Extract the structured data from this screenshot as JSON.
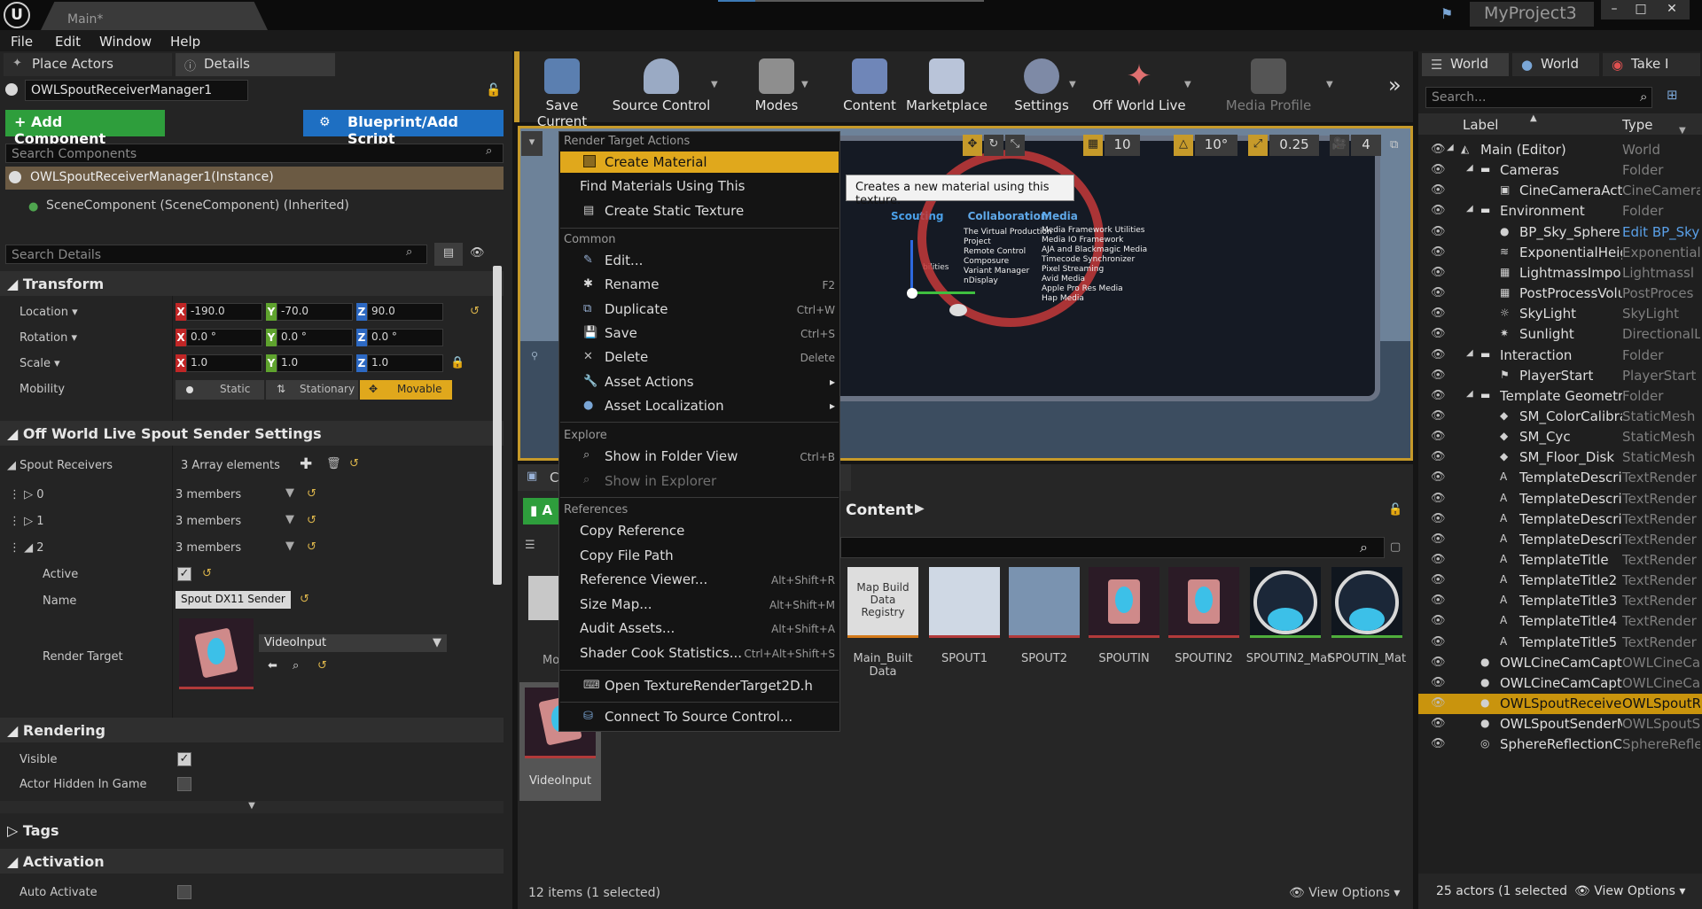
{
  "title_bar": {
    "doc_tab": "Main*",
    "project": "MyProject3",
    "minimize": "–",
    "maximize": "□",
    "close": "✕"
  },
  "menu": [
    "File",
    "Edit",
    "Window",
    "Help"
  ],
  "left_panel": {
    "tabs": [
      "Place Actors",
      "Details"
    ],
    "actor_name": "OWLSpoutReceiverManager1",
    "add_component": "+ Add Component",
    "blueprint_button": "Blueprint/Add Script",
    "search_components_placeholder": "Search Components",
    "component_instance": "OWLSpoutReceiverManager1(Instance)",
    "scene_component": "SceneComponent (SceneComponent) (Inherited)",
    "search_details_placeholder": "Search Details",
    "transform": {
      "header": "Transform",
      "location_label": "Location",
      "location": [
        "-190.0",
        "-70.0",
        "90.0"
      ],
      "rotation_label": "Rotation",
      "rotation": [
        "0.0 °",
        "0.0 °",
        "0.0 °"
      ],
      "scale_label": "Scale",
      "scale": [
        "1.0",
        "1.0",
        "1.0"
      ],
      "mobility_label": "Mobility",
      "mobility_options": [
        "Static",
        "Stationary",
        "Movable"
      ]
    },
    "owl": {
      "header": "Off World Live Spout Sender Settings",
      "receivers_label": "Spout Receivers",
      "receivers_count": "3 Array elements",
      "items": [
        {
          "index": "0",
          "members": "3 members"
        },
        {
          "index": "1",
          "members": "3 members"
        },
        {
          "index": "2",
          "members": "3 members"
        }
      ],
      "active_label": "Active",
      "name_label": "Name",
      "name_value": "Spout DX11 Sender",
      "render_target_label": "Render Target",
      "render_target_value": "VideoInput"
    },
    "rendering": {
      "header": "Rendering",
      "visible_label": "Visible",
      "hidden_label": "Actor Hidden In Game"
    },
    "tags_header": "Tags",
    "activation": {
      "header": "Activation",
      "auto_activate": "Auto Activate"
    }
  },
  "toolbar": {
    "buttons": [
      "Save Current",
      "Source Control",
      "Modes",
      "Content",
      "Marketplace",
      "Settings",
      "Off World Live",
      "Media Profile"
    ],
    "overflow": "»"
  },
  "viewport": {
    "snap_grid": "10",
    "snap_rot": "10°",
    "snap_scale": "0.25",
    "cam_speed": "4",
    "board_left": "Collaboration",
    "board_right": "Media",
    "board_items_left": [
      "The Virtual Production Project",
      "Remote Control",
      "Composure",
      "Variant Manager",
      "nDisplay"
    ],
    "board_items_right": [
      "Media Framework Utilities",
      "Media IO Framework",
      "AJA and Blackmagic Media",
      "Timecode Synchronizer",
      "Pixel Streaming",
      "Avid Media",
      "Apple Pro Res Media",
      "Hap Media"
    ],
    "scouting": "Scouting",
    "abilities": "bilities"
  },
  "context_menu": {
    "section_render": "Render Target Actions",
    "render_items": [
      "Create Material",
      "Find Materials Using This",
      "Create Static Texture"
    ],
    "section_common": "Common",
    "common_items": [
      {
        "label": "Edit...",
        "short": ""
      },
      {
        "label": "Rename",
        "short": "F2"
      },
      {
        "label": "Duplicate",
        "short": "Ctrl+W"
      },
      {
        "label": "Save",
        "short": "Ctrl+S"
      },
      {
        "label": "Delete",
        "short": "Delete"
      },
      {
        "label": "Asset Actions",
        "short": "▸"
      },
      {
        "label": "Asset Localization",
        "short": "▸"
      }
    ],
    "section_explore": "Explore",
    "explore_items": [
      {
        "label": "Show in Folder View",
        "short": "Ctrl+B"
      },
      {
        "label": "Show in Explorer",
        "short": ""
      }
    ],
    "section_references": "References",
    "reference_items": [
      {
        "label": "Copy Reference",
        "short": ""
      },
      {
        "label": "Copy File Path",
        "short": ""
      },
      {
        "label": "Reference Viewer...",
        "short": "Alt+Shift+R"
      },
      {
        "label": "Size Map...",
        "short": "Alt+Shift+M"
      },
      {
        "label": "Audit Assets...",
        "short": "Alt+Shift+A"
      },
      {
        "label": "Shader Cook Statistics...",
        "short": "Ctrl+Alt+Shift+S"
      }
    ],
    "open_item": "Open TextureRenderTarget2D.h",
    "connect_item": "Connect To Source Control..."
  },
  "tooltip": "Creates a new material using this texture.",
  "content_browser": {
    "tab_letter": "C",
    "add_letter": "A",
    "path": "Content",
    "folder_label_partial": "Mo",
    "selected_asset": "VideoInput",
    "map_build_thumb": "Map Build Data Registry",
    "assets": [
      {
        "name": "Main_Built Data"
      },
      {
        "name": "SPOUT1"
      },
      {
        "name": "SPOUT2"
      },
      {
        "name": "SPOUTIN"
      },
      {
        "name": "SPOUTIN2"
      },
      {
        "name": "SPOUTIN2_Mat"
      },
      {
        "name": "SPOUTIN_Mat"
      }
    ],
    "status": "12 items (1 selected)",
    "view_options": "View Options"
  },
  "outliner": {
    "tabs": [
      "World",
      "World",
      "Take I"
    ],
    "search_placeholder": "Search...",
    "col_label": "Label",
    "col_type": "Type",
    "rows": [
      {
        "name": "Main (Editor)",
        "type": "World",
        "indent": 0,
        "icon": "world"
      },
      {
        "name": "Cameras",
        "type": "Folder",
        "indent": 1,
        "icon": "folder"
      },
      {
        "name": "CineCameraActor",
        "type": "CineCamera",
        "indent": 2,
        "icon": "camera"
      },
      {
        "name": "Environment",
        "type": "Folder",
        "indent": 1,
        "icon": "folder"
      },
      {
        "name": "BP_Sky_Sphere",
        "type": "Edit BP_Sky",
        "indent": 2,
        "icon": "sphere"
      },
      {
        "name": "ExponentialHeigh",
        "type": "Exponential",
        "indent": 2,
        "icon": "fog"
      },
      {
        "name": "LightmassImporta",
        "type": "Lightmassl",
        "indent": 2,
        "icon": "volume"
      },
      {
        "name": "PostProcessVolu",
        "type": "PostProces",
        "indent": 2,
        "icon": "volume"
      },
      {
        "name": "SkyLight",
        "type": "SkyLight",
        "indent": 2,
        "icon": "light"
      },
      {
        "name": "Sunlight",
        "type": "DirectionalL",
        "indent": 2,
        "icon": "sun"
      },
      {
        "name": "Interaction",
        "type": "Folder",
        "indent": 1,
        "icon": "folder"
      },
      {
        "name": "PlayerStart",
        "type": "PlayerStart",
        "indent": 2,
        "icon": "flag"
      },
      {
        "name": "Template Geometry",
        "type": "Folder",
        "indent": 1,
        "icon": "folder"
      },
      {
        "name": "SM_ColorCalibrat",
        "type": "StaticMesh",
        "indent": 2,
        "icon": "mesh"
      },
      {
        "name": "SM_Cyc",
        "type": "StaticMesh",
        "indent": 2,
        "icon": "mesh"
      },
      {
        "name": "SM_Floor_Disk",
        "type": "StaticMesh",
        "indent": 2,
        "icon": "mesh"
      },
      {
        "name": "TemplateDescript",
        "type": "TextRender",
        "indent": 2,
        "icon": "text"
      },
      {
        "name": "TemplateDescript",
        "type": "TextRender",
        "indent": 2,
        "icon": "text"
      },
      {
        "name": "TemplateDescript",
        "type": "TextRender",
        "indent": 2,
        "icon": "text"
      },
      {
        "name": "TemplateDescript",
        "type": "TextRender",
        "indent": 2,
        "icon": "text"
      },
      {
        "name": "TemplateTitle",
        "type": "TextRender",
        "indent": 2,
        "icon": "text"
      },
      {
        "name": "TemplateTitle2",
        "type": "TextRender",
        "indent": 2,
        "icon": "text"
      },
      {
        "name": "TemplateTitle3",
        "type": "TextRender",
        "indent": 2,
        "icon": "text"
      },
      {
        "name": "TemplateTitle4",
        "type": "TextRender",
        "indent": 2,
        "icon": "text"
      },
      {
        "name": "TemplateTitle5",
        "type": "TextRender",
        "indent": 2,
        "icon": "text"
      },
      {
        "name": "OWLCineCamCaptu",
        "type": "OWLCineCa",
        "indent": 1,
        "icon": "sphere"
      },
      {
        "name": "OWLCineCamCaptu",
        "type": "OWLCineCa",
        "indent": 1,
        "icon": "sphere"
      },
      {
        "name": "OWLSpoutReceiverl",
        "type": "OWLSpoutR",
        "indent": 1,
        "icon": "sphere",
        "selected": true
      },
      {
        "name": "OWLSpoutSenderM",
        "type": "OWLSpoutS",
        "indent": 1,
        "icon": "sphere"
      },
      {
        "name": "SphereReflectionCa",
        "type": "SphereRefle",
        "indent": 1,
        "icon": "reflect"
      }
    ],
    "status": "25 actors (1 selected",
    "view_options": "View Options"
  },
  "colors": {
    "accent": "#e0a81c",
    "selection": "#c9940d",
    "green": "#2e9e3c",
    "blue": "#1e6fc2"
  }
}
